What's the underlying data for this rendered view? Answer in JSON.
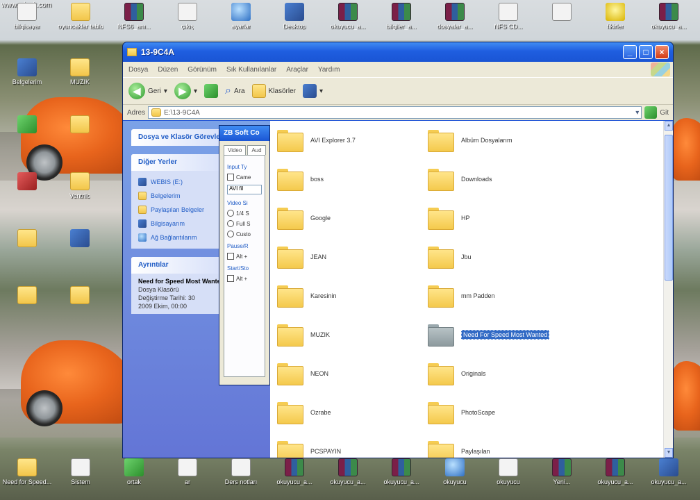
{
  "desktop": {
    "url_text": "www.cdxoft.com",
    "top_icons": [
      {
        "label": "bilgisayar",
        "kind": "g-doc"
      },
      {
        "label": "oyuncaklar tablo",
        "kind": "g-folder"
      },
      {
        "label": "NFS6_anı...",
        "kind": "g-rar"
      },
      {
        "label": "çıkış",
        "kind": "g-doc"
      },
      {
        "label": "ayarlar",
        "kind": "g-globe"
      },
      {
        "label": "Desktop",
        "kind": "g-app"
      },
      {
        "label": "okuyucu_a...",
        "kind": "g-rar"
      },
      {
        "label": "bilgiler_a...",
        "kind": "g-rar"
      },
      {
        "label": "dosyalar_a...",
        "kind": "g-rar"
      },
      {
        "label": "NFS CD...",
        "kind": "g-doc"
      },
      {
        "label": "",
        "kind": "g-doc"
      },
      {
        "label": "fikirler",
        "kind": "g-bulb"
      },
      {
        "label": "okuyucu_a...",
        "kind": "g-rar"
      }
    ],
    "left_icons": [
      {
        "label": "Belgelerim",
        "kind": "g-app"
      },
      {
        "label": "MUZIK",
        "kind": "g-folder"
      },
      {
        "label": "",
        "kind": "g-green"
      },
      {
        "label": "",
        "kind": "g-folder"
      },
      {
        "label": "",
        "kind": "g-red"
      },
      {
        "label": "Ventrilo",
        "kind": "g-folder"
      },
      {
        "label": "",
        "kind": "g-folder"
      },
      {
        "label": "",
        "kind": "g-app"
      },
      {
        "label": "",
        "kind": "g-folder"
      },
      {
        "label": "",
        "kind": "g-folder"
      }
    ],
    "bottom_icons": [
      {
        "label": "Need for Speed...",
        "kind": "g-folder"
      },
      {
        "label": "Sistem",
        "kind": "g-doc"
      },
      {
        "label": "ortak",
        "kind": "g-green"
      },
      {
        "label": "ar",
        "kind": "g-doc"
      },
      {
        "label": "Ders notları",
        "kind": "g-doc"
      },
      {
        "label": "okuyucu_a...",
        "kind": "g-rar"
      },
      {
        "label": "okuyucu_a...",
        "kind": "g-rar"
      },
      {
        "label": "okuyucu_a...",
        "kind": "g-rar"
      },
      {
        "label": "okuyucu",
        "kind": "g-globe"
      },
      {
        "label": "okuyucu",
        "kind": "g-doc"
      },
      {
        "label": "Yeni...",
        "kind": "g-rar"
      },
      {
        "label": "okuyucu_a...",
        "kind": "g-rar"
      },
      {
        "label": "okuyucu_a...",
        "kind": "g-app"
      }
    ]
  },
  "window": {
    "title": "13-9C4A",
    "menu": [
      "Dosya",
      "Düzen",
      "Görünüm",
      "Sık Kullanılanlar",
      "Araçlar",
      "Yardım"
    ],
    "toolbar": {
      "back": "Geri",
      "search": "Ara",
      "folders": "Klasörler"
    },
    "address": {
      "label": "Adres",
      "value": "E:\\13-9C4A",
      "go": "Git"
    },
    "sidebar": {
      "tasks_title": "Dosya ve Klasör Görevleri",
      "other_places_title": "Diğer Yerler",
      "other_places": [
        {
          "label": "WEBIS (E:)"
        },
        {
          "label": "Belgelerim"
        },
        {
          "label": "Paylaşılan Belgeler"
        },
        {
          "label": "Bilgisayarım"
        },
        {
          "label": "Ağ Bağlantılarım"
        }
      ],
      "details_title": "Ayrıntılar",
      "details_name": "Need for Speed Most Wanted",
      "details_type": "Dosya Klasörü",
      "details_modified": "Değiştirme Tarihi: 30",
      "details_date": "2009 Ekim, 00:00"
    },
    "dialog": {
      "title": "ZB Soft Co",
      "tabs": [
        "Video",
        "Aud"
      ],
      "group1": "Input Ty",
      "opt1": "Came",
      "select": "AVI fil",
      "group2": "Video Si",
      "radio1": "1/4 S",
      "radio2": "Full S",
      "radio3": "Custo",
      "group3": "Pause/R",
      "check1": "Alt +",
      "group4": "Start/Sto",
      "check2": "Alt +"
    },
    "files": [
      {
        "name": "AVI Explorer 3.7",
        "color": "yellow",
        "selected": false
      },
      {
        "name": "Albüm Dosyalarım",
        "color": "yellow",
        "selected": false
      },
      {
        "name": "boss",
        "color": "yellow",
        "selected": false
      },
      {
        "name": "Downloads",
        "color": "yellow",
        "selected": false
      },
      {
        "name": "Google",
        "color": "yellow",
        "selected": false
      },
      {
        "name": "HP",
        "color": "yellow",
        "selected": false
      },
      {
        "name": "JEAN",
        "color": "yellow",
        "selected": false
      },
      {
        "name": "Jbu",
        "color": "yellow",
        "selected": false
      },
      {
        "name": "Karesinin",
        "color": "yellow",
        "selected": false
      },
      {
        "name": "mm Padden",
        "color": "yellow",
        "selected": false
      },
      {
        "name": "MUZIK",
        "color": "yellow",
        "selected": false
      },
      {
        "name": "Need For Speed Most Wanted",
        "color": "grey",
        "selected": true
      },
      {
        "name": "NEON",
        "color": "yellow",
        "selected": false
      },
      {
        "name": "Originals",
        "color": "yellow",
        "selected": false
      },
      {
        "name": "Ozrabe",
        "color": "yellow",
        "selected": false
      },
      {
        "name": "PhotoScape",
        "color": "yellow",
        "selected": false
      },
      {
        "name": "PCSPAYIN",
        "color": "yellow",
        "selected": false
      },
      {
        "name": "Paylaşılan",
        "color": "yellow",
        "selected": false
      }
    ]
  },
  "colors": {
    "title_blue": "#1f5ee0",
    "selection": "#316ac5",
    "sidebar_link": "#215dc6"
  }
}
